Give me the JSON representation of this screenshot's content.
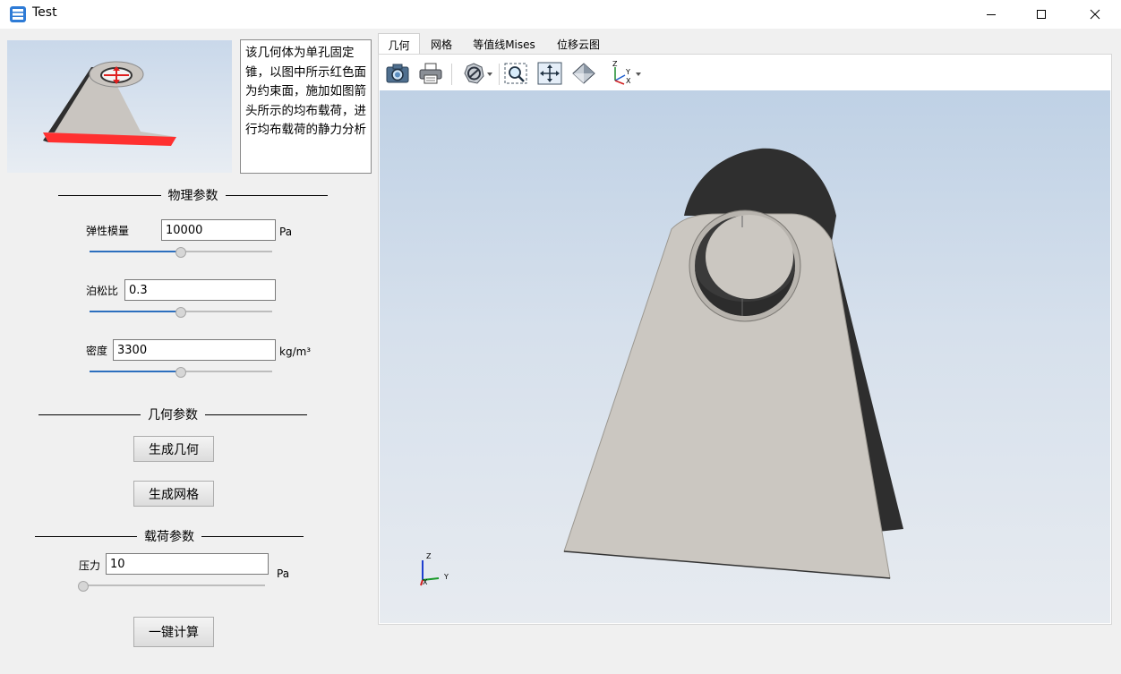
{
  "window": {
    "title": "Test",
    "controls": [
      "minimize",
      "maximize",
      "close"
    ]
  },
  "left_panel": {
    "description": "该几何体为单孔固定锥，以图中所示红色面为约束面，施加如图箭头所示的均布载荷，进行均布载荷的静力分析",
    "physical": {
      "title": "物理参数",
      "elastic_modulus": {
        "label": "弹性模量",
        "value": "10000",
        "unit": "Pa",
        "slider_fraction": 0.5
      },
      "poisson_ratio": {
        "label": "泊松比",
        "value": "0.3",
        "slider_fraction": 0.5
      },
      "density": {
        "label": "密度",
        "value": "3300",
        "unit": "kg/m³",
        "slider_fraction": 0.5
      }
    },
    "geometry": {
      "title": "几何参数",
      "generate_geometry": "生成几何",
      "generate_mesh": "生成网格"
    },
    "load": {
      "title": "载荷参数",
      "pressure": {
        "label": "压力",
        "value": "10",
        "unit": "Pa",
        "slider_fraction": 0.0
      },
      "compute": "一键计算"
    }
  },
  "right_panel": {
    "tabs": [
      "几何",
      "网格",
      "等值线Mises",
      "位移云图"
    ],
    "active_tab": "几何",
    "toolbar_icons": [
      "camera-icon",
      "printer-icon",
      "display-mode-icon",
      "zoom-window-icon",
      "fit-all-icon",
      "view-cube-icon",
      "axis-orientation-icon"
    ],
    "triad": {
      "x": "X",
      "y": "Y",
      "z": "Z"
    },
    "orientation_axes": {
      "z": "Z",
      "y": "Y",
      "x": "X"
    }
  },
  "colors": {
    "slider_fill": "#2d6fbe",
    "constraint_face": "#ff3030",
    "model_face": "#c9c5c0",
    "model_side": "#2e2e2e"
  }
}
